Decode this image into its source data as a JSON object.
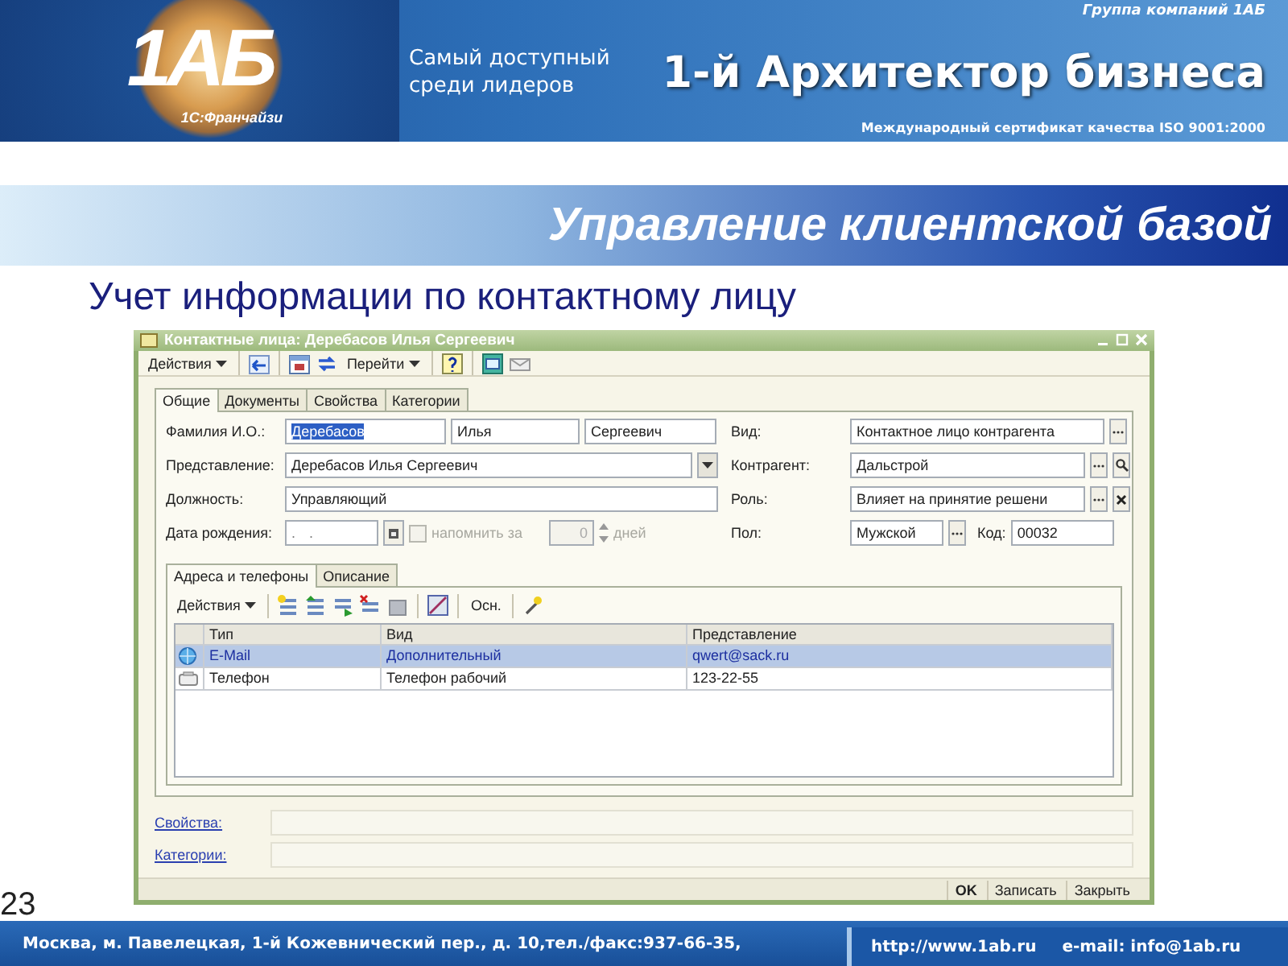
{
  "header": {
    "logo": "1АБ",
    "logo_caption": "1С:Франчайзи",
    "group": "Группа компаний 1АБ",
    "slogan": "Самый доступный среди лидеров",
    "brand": "1-й Архитектор бизнеса",
    "certificate": "Международный сертификат качества ISO 9001:2000"
  },
  "title": "Управление клиентской базой",
  "subtitle": "Учет информации по контактному лицу",
  "page_number": "23",
  "window": {
    "title": "Контактные лица: Деребасов Илья Сергеевич",
    "toolbar": [
      {
        "kind": "menu",
        "label": "Действия"
      },
      {
        "kind": "separator"
      },
      {
        "kind": "icon"
      },
      {
        "kind": "separator"
      },
      {
        "kind": "icon"
      },
      {
        "kind": "icon"
      },
      {
        "kind": "menu",
        "label": "Перейти"
      },
      {
        "kind": "separator"
      },
      {
        "kind": "icon"
      },
      {
        "kind": "separator"
      },
      {
        "kind": "icon"
      },
      {
        "kind": "icon"
      }
    ],
    "tabs": [
      {
        "label": "Общие",
        "selected": true
      },
      {
        "label": "Документы",
        "selected": false
      },
      {
        "label": "Свойства",
        "selected": false
      },
      {
        "label": "Категории",
        "selected": false
      }
    ],
    "fields_left": [
      {
        "kind": "name",
        "label": "Фамилия И.О.:",
        "values": [
          {
            "value": "Деребасов",
            "highlighted": true
          },
          {
            "value": "Илья",
            "highlighted": false
          },
          {
            "value": "Сергеевич",
            "highlighted": false
          }
        ]
      },
      {
        "kind": "dropdown",
        "label": "Представление:",
        "value": "Деребасов Илья Сергеевич"
      },
      {
        "kind": "text",
        "label": "Должность:",
        "value": "Управляющий"
      },
      {
        "kind": "date",
        "label": "Дата рождения:",
        "value": ". .",
        "reminder": {
          "label": "напомнить за",
          "checked": false,
          "disabled": true,
          "days": "0",
          "unit": "дней"
        }
      }
    ],
    "fields_right": [
      {
        "kind": "choice",
        "label": "Вид:",
        "value": "Контактное лицо контрагента"
      },
      {
        "kind": "lookup",
        "label": "Контрагент:",
        "value": "Дальстрой"
      },
      {
        "kind": "clearable",
        "label": "Роль:",
        "value": "Влияет на принятие решени"
      },
      {
        "kind": "coded",
        "label": "Пол:",
        "value": "Мужской",
        "code_label": "Код:",
        "code": "00032"
      }
    ],
    "subtabs": [
      {
        "label": "Адреса и телефоны",
        "selected": true
      },
      {
        "label": "Описание",
        "selected": false
      }
    ],
    "subtoolbar": [
      {
        "kind": "menu",
        "label": "Действия"
      },
      {
        "kind": "separator"
      },
      {
        "kind": "icon"
      },
      {
        "kind": "icon"
      },
      {
        "kind": "icon"
      },
      {
        "kind": "icon"
      },
      {
        "kind": "icon"
      },
      {
        "kind": "separator"
      },
      {
        "kind": "icon"
      },
      {
        "kind": "separator"
      },
      {
        "kind": "button",
        "label": "Осн."
      },
      {
        "kind": "separator"
      },
      {
        "kind": "icon"
      }
    ],
    "table": {
      "columns": [
        "Тип",
        "Вид",
        "Представление"
      ],
      "rows": [
        {
          "kind": "email",
          "cells": [
            "E-Mail",
            "Дополнительный",
            "qwert@sack.ru"
          ],
          "selected": true
        },
        {
          "kind": "phone",
          "cells": [
            "Телефон",
            "Телефон рабочий",
            "123-22-55"
          ],
          "selected": false
        }
      ]
    },
    "links": [
      {
        "label": "Свойства:"
      },
      {
        "label": "Категории:"
      }
    ],
    "buttons": [
      {
        "label": "OK",
        "default": true
      },
      {
        "label": "Записать",
        "default": false
      },
      {
        "label": "Закрыть",
        "default": false
      }
    ]
  },
  "footer": {
    "address": "Москва, м. Павелецкая, 1-й Кожевнический пер., д. 10,тел./факс:937-66-35,",
    "site": "http://www.1ab.ru",
    "email": "e-mail: info@1ab.ru"
  }
}
